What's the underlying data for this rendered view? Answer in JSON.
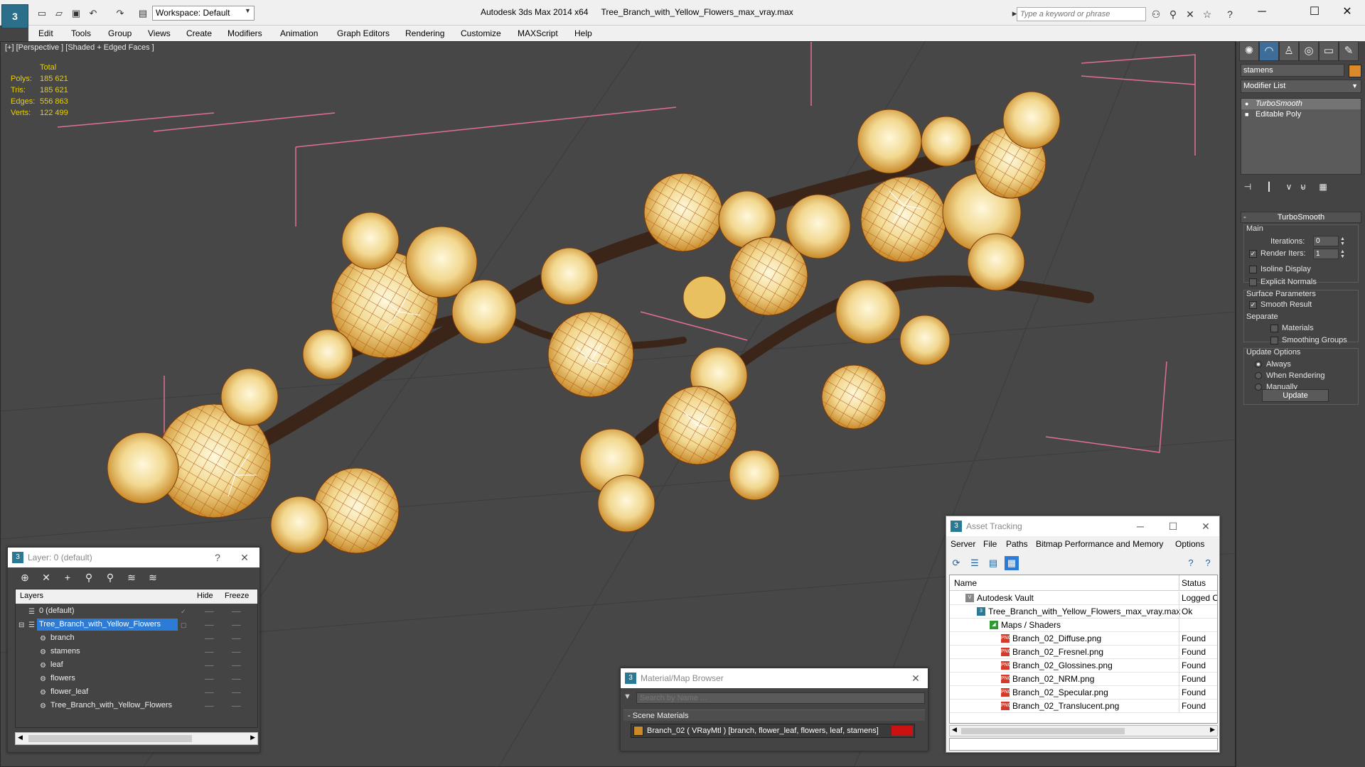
{
  "window": {
    "app_name": "Autodesk 3ds Max  2014 x64",
    "file_name": "Tree_Branch_with_Yellow_Flowers_max_vray.max",
    "workspace": "Workspace: Default",
    "search_placeholder": "Type a keyword or phrase"
  },
  "menu": [
    "Edit",
    "Tools",
    "Group",
    "Views",
    "Create",
    "Modifiers",
    "Animation",
    "Graph Editors",
    "Rendering",
    "Customize",
    "MAXScript",
    "Help"
  ],
  "viewport": {
    "label": "[+] [Perspective ] [Shaded + Edged Faces ]",
    "stats_header": "Total",
    "stats": [
      {
        "label": "Polys:",
        "value": "185 621"
      },
      {
        "label": "Tris:",
        "value": "185 621"
      },
      {
        "label": "Edges:",
        "value": "556 863"
      },
      {
        "label": "Verts:",
        "value": "122 499"
      }
    ]
  },
  "command_panel": {
    "object_name": "stamens",
    "object_color": "#d98a2b",
    "modifier_list": "Modifier List",
    "stack": [
      "TurboSmooth",
      "Editable Poly"
    ],
    "rollout_title": "TurboSmooth",
    "main_label": "Main",
    "iterations_label": "Iterations:",
    "iterations_value": "0",
    "render_iters_label": "Render Iters:",
    "render_iters_value": "1",
    "isoline_label": "Isoline Display",
    "explicit_normals_label": "Explicit Normals",
    "surface_params_label": "Surface Parameters",
    "smooth_result_label": "Smooth Result",
    "separate_label": "Separate",
    "materials_label": "Materials",
    "smoothing_groups_label": "Smoothing Groups",
    "update_options_label": "Update Options",
    "always_label": "Always",
    "when_rendering_label": "When Rendering",
    "manually_label": "Manually",
    "update_button": "Update"
  },
  "layer_window": {
    "title": "Layer: 0 (default)",
    "help": "?",
    "col_layers": "Layers",
    "col_hide": "Hide",
    "col_freeze": "Freeze",
    "rows": [
      {
        "name": "0 (default)",
        "type": "layer"
      },
      {
        "name": "Tree_Branch_with_Yellow_Flowers",
        "type": "layer"
      },
      {
        "name": "branch",
        "type": "object"
      },
      {
        "name": "stamens",
        "type": "object"
      },
      {
        "name": "leaf",
        "type": "object"
      },
      {
        "name": "flowers",
        "type": "object"
      },
      {
        "name": "flower_leaf",
        "type": "object"
      },
      {
        "name": "Tree_Branch_with_Yellow_Flowers",
        "type": "object"
      }
    ]
  },
  "material_browser": {
    "title": "Material/Map Browser",
    "search_placeholder": "Search by Name ...",
    "section": "Scene Materials",
    "item": "Branch_02  ( VRayMtl )  [branch, flower_leaf, flowers, leaf, stamens]",
    "swatch_color": "#cc1111"
  },
  "asset_tracking": {
    "title": "Asset Tracking",
    "menu": [
      "Server",
      "File",
      "Paths",
      "Bitmap Performance and Memory",
      "Options"
    ],
    "col_name": "Name",
    "col_status": "Status",
    "rows": [
      {
        "name": "Autodesk Vault",
        "status": "Logged Out",
        "indent": 0
      },
      {
        "name": "Tree_Branch_with_Yellow_Flowers_max_vray.max",
        "status": "Ok",
        "indent": 1
      },
      {
        "name": "Maps / Shaders",
        "status": "",
        "indent": 2
      },
      {
        "name": "Branch_02_Diffuse.png",
        "status": "Found",
        "indent": 3
      },
      {
        "name": "Branch_02_Fresnel.png",
        "status": "Found",
        "indent": 3
      },
      {
        "name": "Branch_02_Glossines.png",
        "status": "Found",
        "indent": 3
      },
      {
        "name": "Branch_02_NRM.png",
        "status": "Found",
        "indent": 3
      },
      {
        "name": "Branch_02_Specular.png",
        "status": "Found",
        "indent": 3
      },
      {
        "name": "Branch_02_Translucent.png",
        "status": "Found",
        "indent": 3
      }
    ]
  },
  "colors": {
    "stats_yellow": "#e8d000",
    "selection_blue": "#2c7bd6",
    "bounding_box_pink": "#e07090",
    "wire_orange": "#b45a14"
  }
}
